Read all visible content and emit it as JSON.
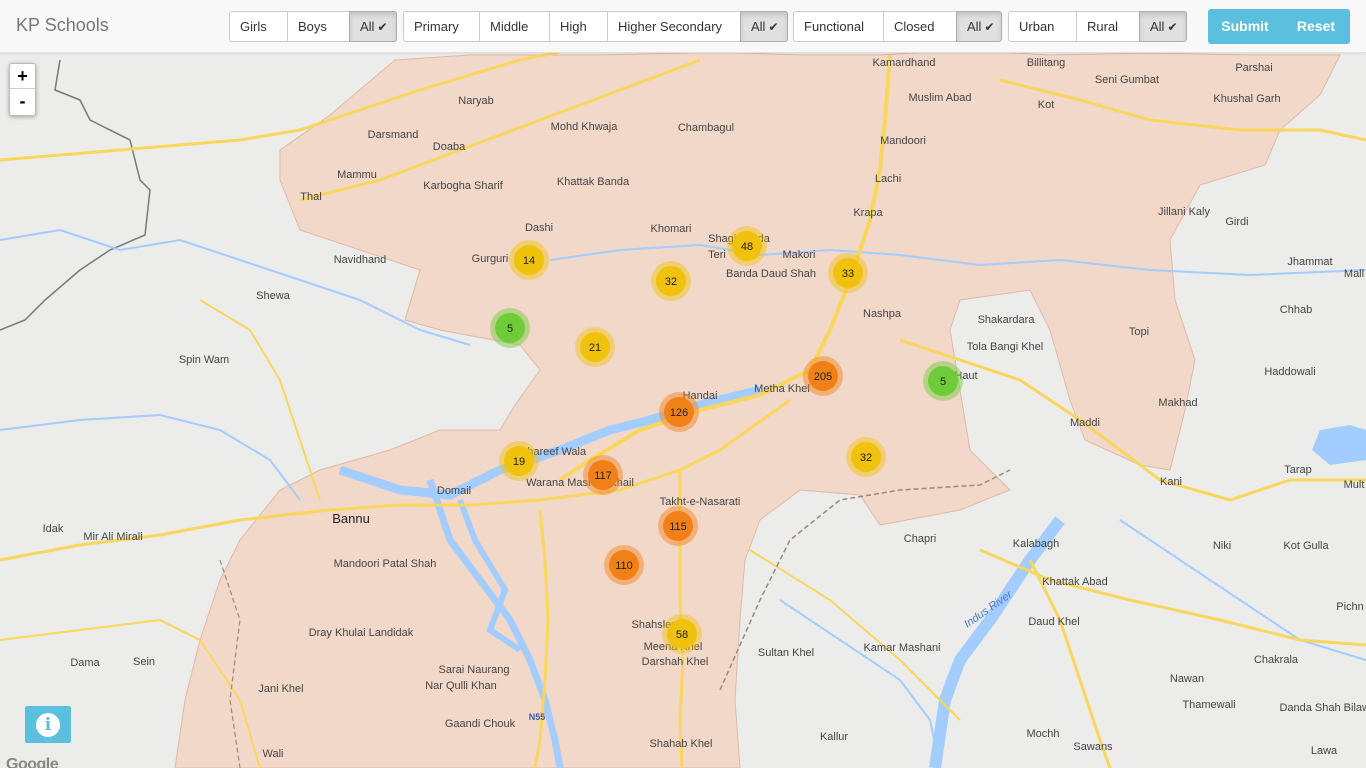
{
  "app": {
    "title": "KP Schools"
  },
  "filters": {
    "gender": [
      {
        "label": "Girls",
        "active": false
      },
      {
        "label": "Boys",
        "active": false
      },
      {
        "label": "All",
        "active": true
      }
    ],
    "level": [
      {
        "label": "Primary",
        "active": false
      },
      {
        "label": "Middle",
        "active": false
      },
      {
        "label": "High",
        "active": false
      },
      {
        "label": "Higher Secondary",
        "active": false
      },
      {
        "label": "All",
        "active": true
      }
    ],
    "status": [
      {
        "label": "Functional",
        "active": false
      },
      {
        "label": "Closed",
        "active": false
      },
      {
        "label": "All",
        "active": true
      }
    ],
    "area": [
      {
        "label": "Urban",
        "active": false
      },
      {
        "label": "Rural",
        "active": false
      },
      {
        "label": "All",
        "active": true
      }
    ]
  },
  "actions": {
    "submit": "Submit",
    "reset": "Reset"
  },
  "zoom": {
    "in": "+",
    "out": "-"
  },
  "icons": {
    "check": "check-icon",
    "info": "info-icon"
  },
  "colors": {
    "accent": "#5bc0de",
    "region_fill": "#f2d8c9",
    "cluster_small": "#6ecc39",
    "cluster_medium": "#f0c20c",
    "cluster_large": "#f18017",
    "water": "#a3ccff",
    "road": "#f9d65c"
  },
  "clusters": [
    {
      "count": "14",
      "tier": "medium"
    },
    {
      "count": "48",
      "tier": "medium"
    },
    {
      "count": "32",
      "tier": "medium"
    },
    {
      "count": "33",
      "tier": "medium"
    },
    {
      "count": "5",
      "tier": "small"
    },
    {
      "count": "21",
      "tier": "medium"
    },
    {
      "count": "205",
      "tier": "large"
    },
    {
      "count": "5",
      "tier": "small"
    },
    {
      "count": "126",
      "tier": "large"
    },
    {
      "count": "32",
      "tier": "medium"
    },
    {
      "count": "19",
      "tier": "medium"
    },
    {
      "count": "117",
      "tier": "large"
    },
    {
      "count": "115",
      "tier": "large"
    },
    {
      "count": "110",
      "tier": "large"
    },
    {
      "count": "58",
      "tier": "medium"
    }
  ],
  "places": [
    "Naryab",
    "Mohd Khwaja",
    "Chambagul",
    "Kamardhand",
    "Billitang",
    "Seni Gumbat",
    "Parshai",
    "Darsmand",
    "Doaba",
    "Muslim Abad",
    "Kot",
    "Khushal Garh",
    "Mandoori",
    "Mammu",
    "Khattak Banda",
    "Lachi",
    "Karbogha Sharif",
    "Thal",
    "Krapa",
    "Jillani Kaly",
    "Girdi",
    "Dashi",
    "Khomari",
    "Shagi Landa",
    "Teri",
    "Makori",
    "Navidhand",
    "Gurguri",
    "Banda Daud Shah",
    "Jhammat",
    "Shewa",
    "Nashpa",
    "Shakardara",
    "Chhab",
    "Topi",
    "Tola Bangi Khel",
    "Spin Wam",
    "Haddowali",
    "Handai",
    "Metha Khel",
    "Haut",
    "Makhad",
    "Maddi",
    "Shareef Wala",
    "Tarap",
    "Kani",
    "Warana Mashan Khail",
    "Domail",
    "Idak",
    "Mir Ali Mirali",
    "Takht-e-Nasarati",
    "Bannu",
    "Chapri",
    "Kalabagh",
    "Niki",
    "Kot Gulla",
    "Khattak Abad",
    "Mandoori Patal Shah",
    "Indus River",
    "Daud Khel",
    "Pichn",
    "Dray Khulai Landidak",
    "Shahslem",
    "Meena Khel",
    "Darshah Khel",
    "Sultan Khel",
    "Kamar Mashani",
    "Chakrala",
    "Dama",
    "Sein",
    "Jani Khel",
    "Sarai Naurang",
    "Nar Qulli Khan",
    "Nawan",
    "Thamewali",
    "Danda Shah Bilawal",
    "Gaandi Chouk",
    "Wali",
    "Shahab Khel",
    "Kallur",
    "Mochh",
    "Sawans",
    "Lawa",
    "Mall",
    "Mult",
    "N55"
  ],
  "attribution": "Google"
}
